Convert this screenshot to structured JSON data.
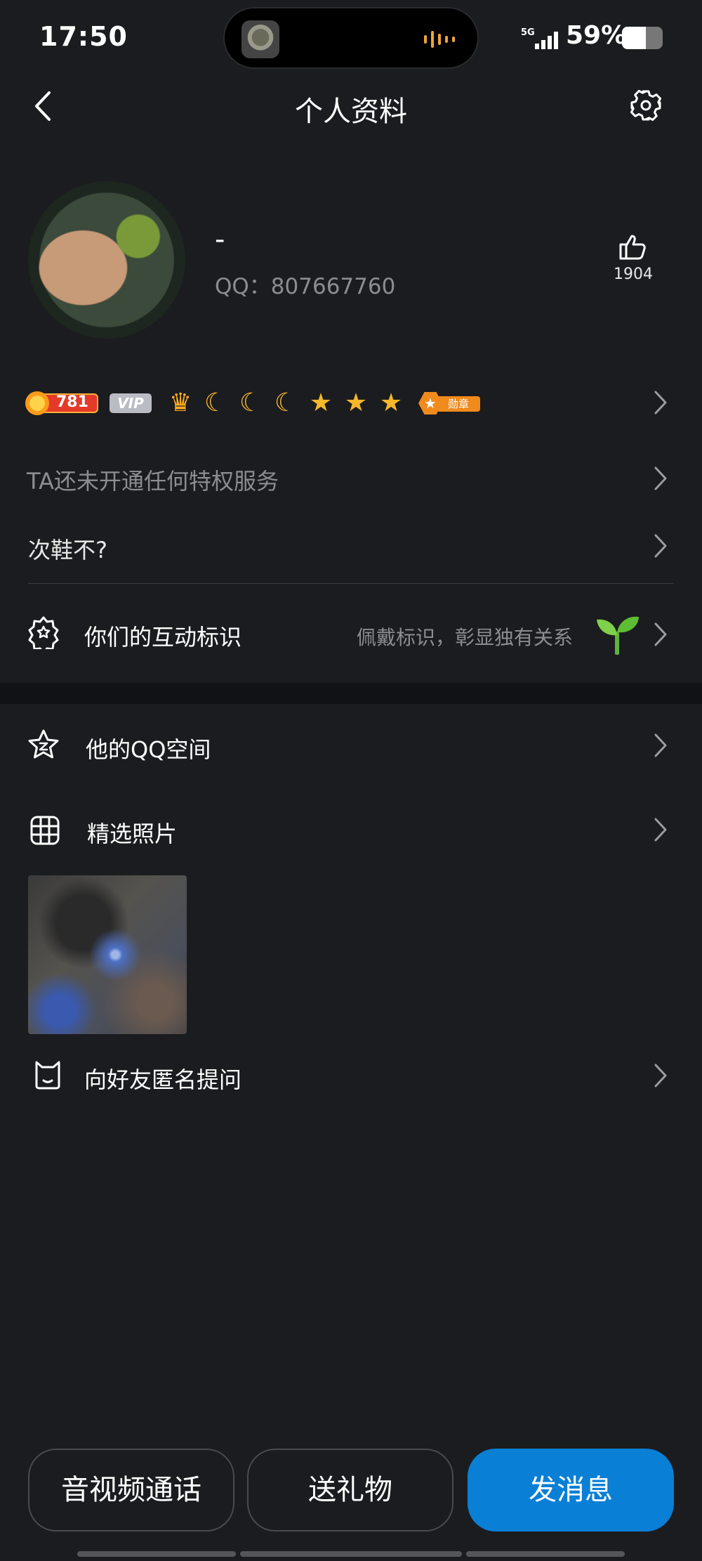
{
  "status_bar": {
    "time": "17:50",
    "network": "5G",
    "battery_percent": "59%",
    "battery_level": 0.59
  },
  "nav": {
    "title": "个人资料"
  },
  "profile": {
    "nickname": "-",
    "qq_id": "QQ：807667760",
    "like_count": "1904"
  },
  "badges": {
    "sun_level": "781",
    "vip_label": "VIP",
    "medal_label": "勋章"
  },
  "rows": {
    "privilege": "TA还未开通任何特权服务",
    "motto": "次鞋不?",
    "interaction": {
      "label": "你们的互动标识",
      "hint": "佩戴标识，彰显独有关系"
    },
    "qzone": "他的QQ空间",
    "photos": "精选照片",
    "anonymous_ask": "向好友匿名提问"
  },
  "actions": {
    "call": "音视频通话",
    "gift": "送礼物",
    "message": "发消息"
  },
  "colors": {
    "background": "#1b1c1f",
    "primary_button": "#0a7fd6",
    "secondary_text": "#8b8d92"
  }
}
